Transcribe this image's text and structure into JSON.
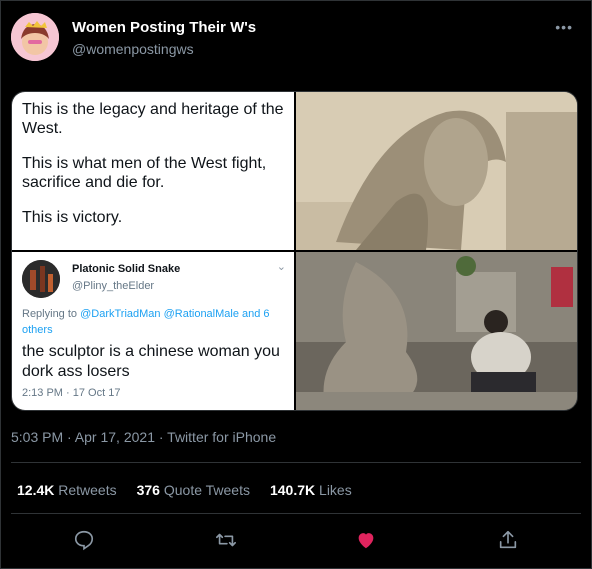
{
  "account": {
    "name": "Women Posting Their W's",
    "handle": "@womenpostingws"
  },
  "more_label": "•••",
  "panel_text": {
    "line1": "This is the legacy and heritage of the West.",
    "line2": "This is what men of the West fight, sacrifice and die for.",
    "line3": "This is victory."
  },
  "quoted_tweet": {
    "name": "Platonic Solid Snake",
    "handle": "@Pliny_theElder",
    "chevron": "⌄",
    "replying_prefix": "Replying to ",
    "replying_links": "@DarkTriadMan @RationalMale and 6 others",
    "text": "the sculptor is a chinese woman you dork ass losers",
    "time": "2:13 PM · 17 Oct 17"
  },
  "meta": "5:03 PM · Apr 17, 2021 · Twitter for iPhone",
  "stats": {
    "retweets_count": "12.4K",
    "retweets_label": " Retweets",
    "quotes_count": "376",
    "quotes_label": " Quote Tweets",
    "likes_count": "140.7K",
    "likes_label": " Likes"
  },
  "icons": {
    "reply": "reply-icon",
    "retweet": "retweet-icon",
    "like": "heart-icon",
    "share": "share-icon",
    "like_color": "#e0245e",
    "icon_color": "#8b98a5"
  }
}
